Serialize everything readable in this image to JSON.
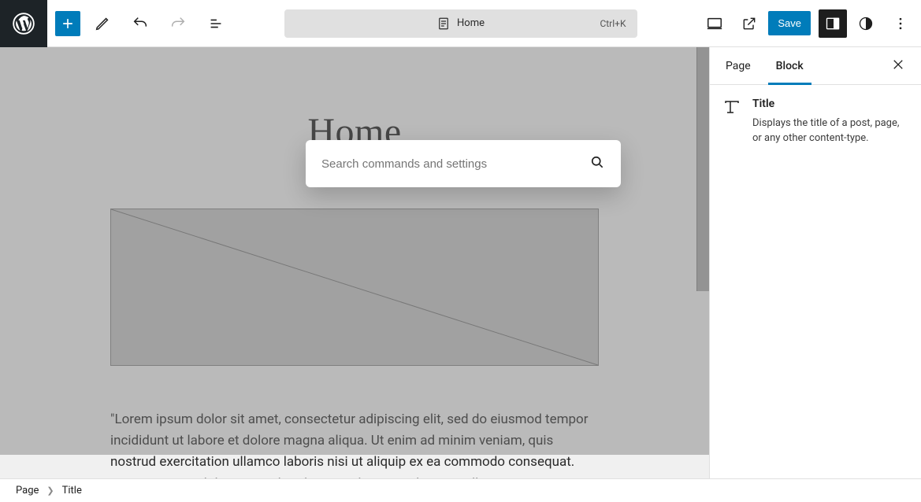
{
  "toolbar": {
    "doc_title": "Home",
    "shortcut": "Ctrl+K",
    "save_label": "Save"
  },
  "command_palette": {
    "placeholder": "Search commands and settings"
  },
  "sidebar": {
    "tabs": {
      "page": "Page",
      "block": "Block"
    },
    "block": {
      "title": "Title",
      "description": "Displays the title of a post, page, or any other content-type."
    }
  },
  "canvas": {
    "page_title": "Home",
    "body_text": "\"Lorem ipsum dolor sit amet, consectetur adipiscing elit, sed do eiusmod tempor incididunt ut labore et dolore magna aliqua. Ut enim ad minim veniam, quis nostrud exercitation ullamco laboris nisi ut aliquip ex ea commodo consequat. Duis aute irure dolor in reprehenderit in voluptate velit esse cillum"
  },
  "breadcrumb": {
    "root": "Page",
    "current": "Title"
  }
}
